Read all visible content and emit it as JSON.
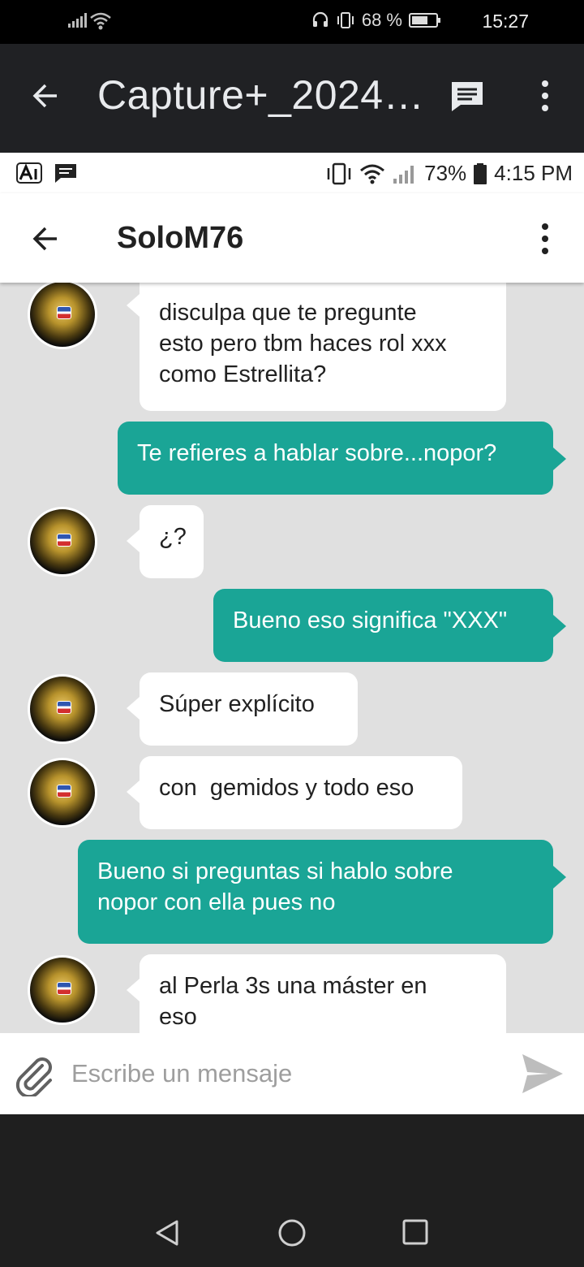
{
  "outer_status": {
    "battery": "68 %",
    "time": "15:27"
  },
  "viewer": {
    "title": "Capture+_2024…"
  },
  "inner_status": {
    "battery": "73%",
    "time": "4:15 PM"
  },
  "chat": {
    "contact_name": "SoloM76"
  },
  "messages": [
    {
      "from": "contact",
      "text": "disculpa que te pregunte\nesto pero tbm haces rol xxx\ncomo Estrellita?"
    },
    {
      "from": "me",
      "text": "Te refieres a hablar sobre...nopor?"
    },
    {
      "from": "contact",
      "text": "¿?"
    },
    {
      "from": "me",
      "text": "Bueno eso significa \"XXX\""
    },
    {
      "from": "contact",
      "text": "Súper explícito"
    },
    {
      "from": "contact",
      "text": "con  gemidos y todo eso"
    },
    {
      "from": "me",
      "text": "Bueno si preguntas si hablo sobre\nnopor con ella pues no"
    },
    {
      "from": "contact",
      "text": "al Perla 3s una máster en\neso"
    }
  ],
  "composer": {
    "placeholder": "Escribe un mensaje"
  },
  "colors": {
    "outgoing_bubble": "#1aa596",
    "chat_background": "#e0e0e0",
    "viewer_bar": "#202124"
  },
  "icons": [
    "back-arrow-icon",
    "message-icon",
    "more-vert-icon",
    "attachment-clip-icon",
    "send-icon",
    "nav-back-icon",
    "nav-home-icon",
    "nav-recents-icon"
  ]
}
